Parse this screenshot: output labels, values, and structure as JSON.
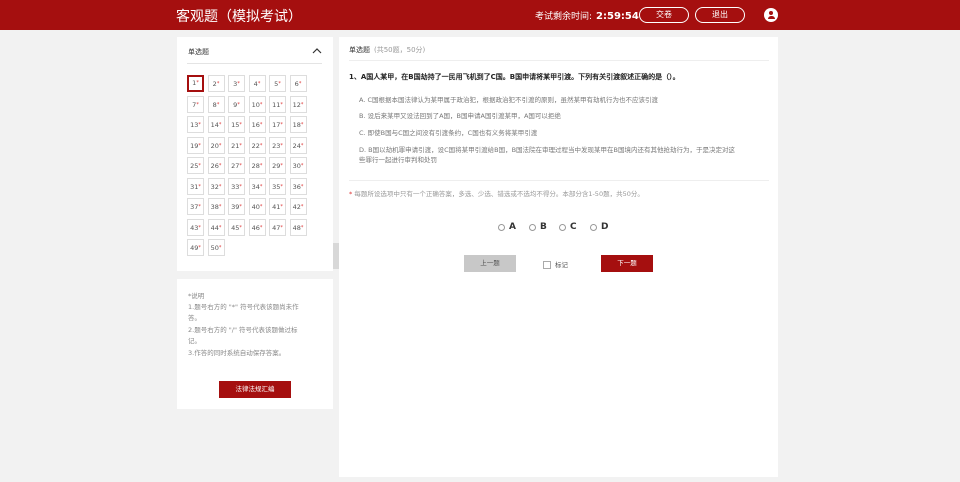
{
  "header": {
    "title": "客观题（模拟考试）",
    "timer_label": "考试剩余时间:",
    "timer_value": "2:59:54",
    "submit_label": "交卷",
    "exit_label": "退出"
  },
  "sidebar": {
    "title": "单选题",
    "questions": [
      "1",
      "2",
      "3",
      "4",
      "5",
      "6",
      "7",
      "8",
      "9",
      "10",
      "11",
      "12",
      "13",
      "14",
      "15",
      "16",
      "17",
      "18",
      "19",
      "20",
      "21",
      "22",
      "23",
      "24",
      "25",
      "26",
      "27",
      "28",
      "29",
      "30",
      "31",
      "32",
      "33",
      "34",
      "35",
      "36",
      "37",
      "38",
      "39",
      "40",
      "41",
      "42",
      "43",
      "44",
      "45",
      "46",
      "47",
      "48",
      "49",
      "50"
    ],
    "unanswered_mark": "*",
    "current": "1"
  },
  "notes": {
    "lines": [
      "*说明",
      "1.题号右方的 \"*\" 符号代表该题尚未作",
      "答。",
      "2.题号右方的 \"/\" 符号代表该题做过标",
      "记。",
      "3.作答的同时系统自动保存答案。"
    ],
    "law_button": "法律法规汇编"
  },
  "main": {
    "section_title": "单选题",
    "section_sub": "(共50题，50分)",
    "question": "1、A国人某甲，在B国劫持了一民用飞机到了C国。B国申请将某甲引渡。下列有关引渡叙述正确的是（）。",
    "options": [
      "A. C国根据本国法律认为某甲属于政治犯，根据政治犯不引渡的原则，虽然某甲有劫机行为也不应该引渡",
      "B. 设后来某甲又设法回到了A国，B国申请A国引渡某甲，A国可以拒绝",
      "C. 即使B国与C国之间没有引渡条约，C国也有义务将某甲引渡",
      "D. B国以劫机罪申请引渡，设C国将某甲引渡给B国，B国法院在审理过程当中发现某甲在B国境内还有其他抢劫行为，于是决定对这",
      "些罪行一起进行审判和处罚"
    ],
    "remark_mark": "*",
    "remark": "每题所设选项中只有一个正确答案，多选、少选、错选或不选均不得分。本部分含1-50题，共50分。",
    "choices": [
      "A",
      "B",
      "C",
      "D"
    ],
    "prev_label": "上一题",
    "mark_label": "标记",
    "next_label": "下一题"
  },
  "colors": {
    "brand": "#a50f0f",
    "unanswered": "#dd3333"
  },
  "icons": {
    "collapse": "chevron-up-icon",
    "user": "user-icon"
  }
}
